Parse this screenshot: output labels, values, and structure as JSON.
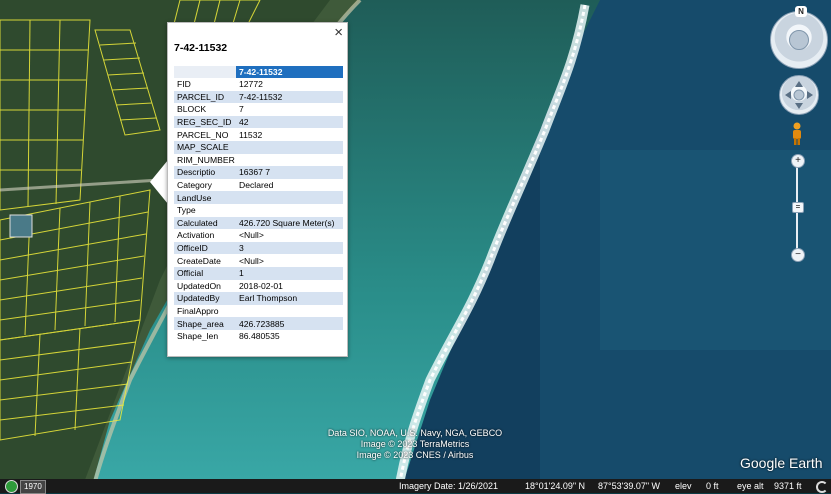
{
  "popup": {
    "title": "7-42-11532",
    "close_label": "×",
    "header_value": "7-42-11532",
    "attributes": [
      {
        "key": "FID",
        "value": "12772"
      },
      {
        "key": "PARCEL_ID",
        "value": "7-42-11532"
      },
      {
        "key": "BLOCK",
        "value": "7"
      },
      {
        "key": "REG_SEC_ID",
        "value": "42"
      },
      {
        "key": "PARCEL_NO",
        "value": "11532"
      },
      {
        "key": "MAP_SCALE",
        "value": ""
      },
      {
        "key": "RIM_NUMBER",
        "value": ""
      },
      {
        "key": "Descriptio",
        "value": "16367 7"
      },
      {
        "key": "Category",
        "value": "Declared"
      },
      {
        "key": "LandUse",
        "value": ""
      },
      {
        "key": "Type",
        "value": ""
      },
      {
        "key": "Calculated",
        "value": "426.720 Square Meter(s)"
      },
      {
        "key": "Activation",
        "value": "<Null>"
      },
      {
        "key": "OfficeID",
        "value": "3"
      },
      {
        "key": "CreateDate",
        "value": "<Null>"
      },
      {
        "key": "Official",
        "value": "1"
      },
      {
        "key": "UpdatedOn",
        "value": "2018-02-01"
      },
      {
        "key": "UpdatedBy",
        "value": "Earl Thompson"
      },
      {
        "key": "FinalAppro",
        "value": ""
      },
      {
        "key": "Shape_area",
        "value": "426.723885"
      },
      {
        "key": "Shape_len",
        "value": "86.480535"
      }
    ]
  },
  "navigation": {
    "north_label": "N",
    "zoom_in_label": "+",
    "zoom_out_label": "−",
    "zoom_thumb_label": "="
  },
  "credits": {
    "line1": "Data SIO, NOAA, U.S. Navy, NGA, GEBCO",
    "line2": "Image © 2023 TerraMetrics",
    "line3": "Image © 2023 CNES / Airbus"
  },
  "brand": "Google Earth",
  "status": {
    "year": "1970",
    "imagery_date": "Imagery Date: 1/26/2021",
    "latitude": "18°01'24.09\" N",
    "longitude": "87°53'39.07\" W",
    "elev_label": "elev",
    "elev_value": "0 ft",
    "eye_alt_label": "eye alt",
    "eye_alt_value": "9371 ft"
  },
  "colors": {
    "parcel_lines": "#f2ee3a",
    "header_highlight": "#1f6fbf",
    "row_shade": "#d6e2f1"
  }
}
